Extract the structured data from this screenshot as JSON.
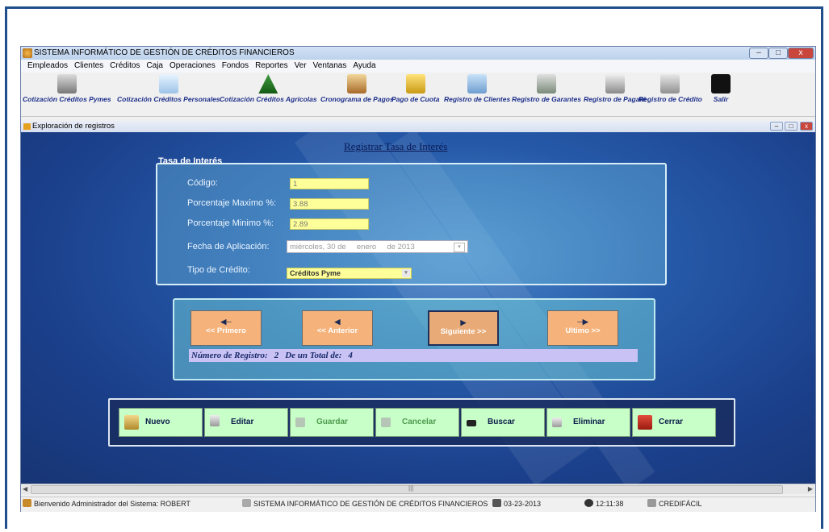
{
  "app": {
    "title": "SISTEMA INFORMÁTICO DE GESTIÓN DE CRÉDITOS FINANCIEROS"
  },
  "menu": [
    "Empleados",
    "Clientes",
    "Créditos",
    "Caja",
    "Operaciones",
    "Fondos",
    "Reportes",
    "Ver",
    "Ventanas",
    "Ayuda"
  ],
  "toolbar": [
    {
      "label": "Cotización Créditos Pymes",
      "icon": "calculator-icon"
    },
    {
      "label": "Cotización Créditos Personales",
      "icon": "skier-icon"
    },
    {
      "label": "Cotización Créditos Agrícolas",
      "icon": "pine-tree-icon"
    },
    {
      "label": "Cronograma de Pagos",
      "icon": "schedule-icon"
    },
    {
      "label": "Pago de Cuota",
      "icon": "payment-icon"
    },
    {
      "label": "Registro de Clientes",
      "icon": "clients-icon"
    },
    {
      "label": "Registro de Garantes",
      "icon": "guarantors-icon"
    },
    {
      "label": "Registro de Pagaré",
      "icon": "promissory-note-icon"
    },
    {
      "label": "Registro de Crédito",
      "icon": "credit-cabinet-icon"
    },
    {
      "label": "Salir",
      "icon": "exit-runner-icon"
    }
  ],
  "mdi": {
    "title": "Exploración de registros"
  },
  "form": {
    "title": "Registrar Tasa de Interés",
    "group_title": "Tasa de Interés",
    "codigo_label": "Código:",
    "codigo_value": "1",
    "max_label": "Porcentaje Maximo %:",
    "max_value": "3.88",
    "min_label": "Porcentaje Minimo %:",
    "min_value": "2.89",
    "fecha_label": "Fecha de Aplicación:",
    "fecha_value": "miércoles, 30 de     enero     de 2013",
    "tipo_label": "Tipo de Crédito:",
    "tipo_value": "Créditos Pyme"
  },
  "nav": {
    "first": "<< Primero",
    "prev": "<< Anterior",
    "next": "Siguiente >>",
    "last": "Ultimo >>",
    "record_label": "Número de Registro:",
    "record_number": "2",
    "total_label": "De un Total de:",
    "total_value": "4"
  },
  "actions": {
    "nuevo": "Nuevo",
    "editar": "Editar",
    "guardar": "Guardar",
    "cancelar": "Cancelar",
    "buscar": "Buscar",
    "eliminar": "Eliminar",
    "cerrar": "Cerrar"
  },
  "status": {
    "welcome": "Bienvenido Administrador del Sistema: ROBERT",
    "system": "SISTEMA INFORMÁTICO DE GESTIÓN DE CRÉDITOS FINANCIEROS",
    "date": "03-23-2013",
    "time": "12:11:38",
    "brand": "CREDIFÁCIL"
  },
  "colors": {
    "field_bg": "#ffff99",
    "nav_button": "#f5b27a",
    "action_button": "#c8ffc8",
    "client_bg": "#2559a8"
  }
}
